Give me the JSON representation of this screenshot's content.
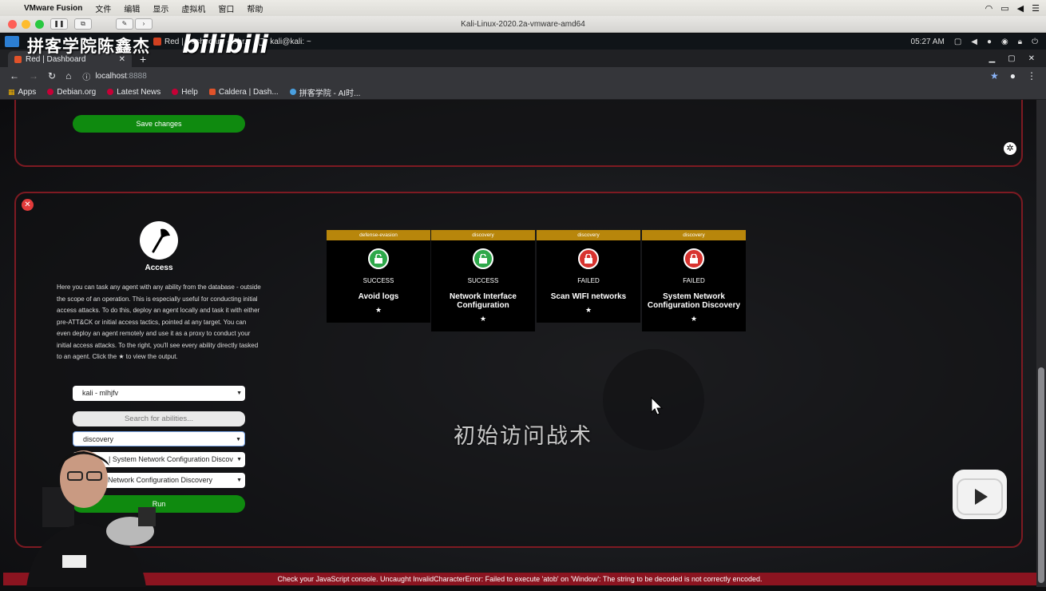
{
  "mac_menubar": {
    "app_name": "VMware Fusion",
    "menu": [
      "文件",
      "编辑",
      "显示",
      "虚拟机",
      "窗口",
      "帮助"
    ]
  },
  "vm_window": {
    "title": "Kali-Linux-2020.2a-vmware-amd64"
  },
  "kali_panel": {
    "tasks": [
      "Red | Dashboard - Chr...",
      "kali@kali: ~"
    ],
    "clock": "05:27 AM"
  },
  "browser": {
    "tab_title": "Red | Dashboard",
    "tab_close": "✕",
    "new_tab": "+",
    "url_host": "localhost",
    "url_port": ":8888",
    "bookmarks": [
      "Apps",
      "Debian.org",
      "Latest News",
      "Help",
      "Caldera | Dash...",
      "拼客学院 - AI时..."
    ]
  },
  "top_panel": {
    "save_label": "Save changes"
  },
  "access": {
    "title": "Access",
    "description": "Here you can task any agent with any ability from the database - outside the scope of an operation. This is especially useful for conducting initial access attacks. To do this, deploy an agent locally and task it with either pre-ATT&CK or initial access tactics, pointed at any target. You can even deploy an agent remotely and use it as a proxy to conduct your initial access attacks. To the right, you'll see every ability directly tasked to an agent. Click the ★ to view the output.",
    "agent_select": "kali - mlhjfv",
    "search_placeholder": "Search for abilities...",
    "tactic_select": "discovery",
    "technique_select": "| System Network Configuration Discov",
    "ability_select": "Network Configuration Discovery",
    "run_label": "Run"
  },
  "cards": [
    {
      "tactic": "defense-evasion",
      "status": "SUCCESS",
      "name": "Avoid logs",
      "star": "★",
      "color": "#2ea84a"
    },
    {
      "tactic": "discovery",
      "status": "SUCCESS",
      "name": "Network Interface Configuration",
      "star": "★",
      "color": "#2ea84a"
    },
    {
      "tactic": "discovery",
      "status": "FAILED",
      "name": "Scan WIFI networks",
      "star": "★",
      "color": "#d8332f"
    },
    {
      "tactic": "discovery",
      "status": "FAILED",
      "name": "System Network Configuration Discovery",
      "star": "★",
      "color": "#d8332f"
    }
  ],
  "subtitle": "初始访问战术",
  "error_message": "Check your JavaScript console. Uncaught InvalidCharacterError: Failed to execute 'atob' on 'Window': The string to be decoded is not correctly encoded.",
  "watermark": {
    "text": "拼客学院陈鑫杰",
    "logo": "bilibili"
  }
}
